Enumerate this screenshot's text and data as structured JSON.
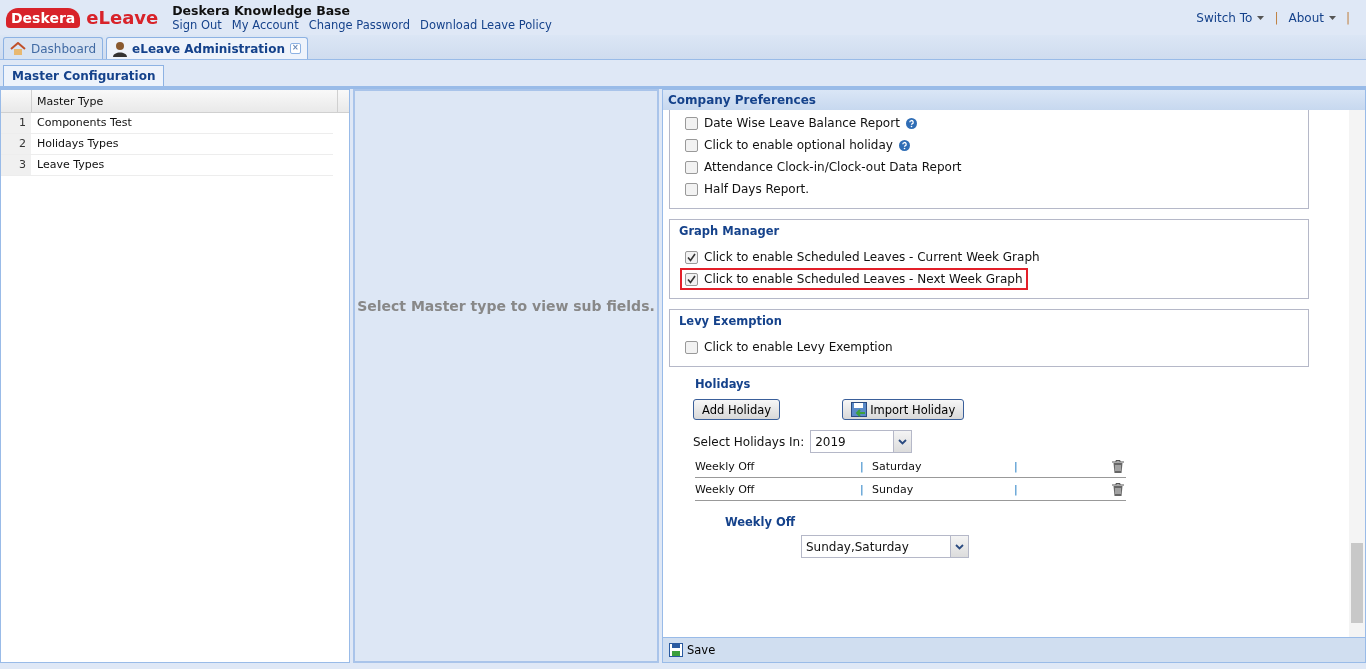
{
  "header": {
    "logo_brand": "Desk",
    "logo_brand_rest": "era",
    "app_name": "eLeave",
    "site_title": "Deskera Knowledge Base",
    "links": [
      "Sign Out",
      "My Account",
      "Change Password",
      "Download Leave Policy"
    ],
    "menus": [
      "Switch To",
      "About"
    ],
    "separator": "|"
  },
  "tabs": [
    {
      "label": "Dashboard",
      "selected": false,
      "kind": "home"
    },
    {
      "label": "eLeave Administration",
      "selected": true,
      "kind": "admin",
      "close": "×"
    }
  ],
  "sub_tabs": [
    {
      "label": "Master Configuration",
      "selected": true
    }
  ],
  "master_grid": {
    "column": "Master Type",
    "rows": [
      {
        "number": "1",
        "name": "Components Test"
      },
      {
        "number": "2",
        "name": "Holidays Types"
      },
      {
        "number": "3",
        "name": "Leave Types"
      }
    ]
  },
  "middle_message": "Select Master type to view sub fields.",
  "preferences": {
    "title": "Company Preferences",
    "report_options": [
      {
        "label": "Date Wise Leave Balance Report",
        "checked": false,
        "help": true
      },
      {
        "label": "Click to enable optional holiday",
        "checked": false,
        "help": true
      },
      {
        "label": "Attendance Clock-in/Clock-out Data Report",
        "checked": false,
        "help": false
      },
      {
        "label": "Half Days Report.",
        "checked": false,
        "help": false
      }
    ],
    "sections": [
      {
        "title": "Graph Manager",
        "options": [
          {
            "label": "Click to enable Scheduled Leaves - Current Week Graph",
            "checked": true,
            "highlighted": false
          },
          {
            "label": "Click to enable Scheduled Leaves - Next Week Graph",
            "checked": true,
            "highlighted": true
          }
        ]
      },
      {
        "title": "Levy Exemption",
        "options": [
          {
            "label": "Click to enable Levy Exemption",
            "checked": false,
            "highlighted": false
          }
        ]
      }
    ],
    "holidays": {
      "title": "Holidays",
      "add_button": "Add Holiday",
      "import_button": "Import Holiday",
      "year_label": "Select Holidays In:",
      "year": "2019",
      "separator": "|",
      "rows": [
        {
          "type": "Weekly Off",
          "day": "Saturday"
        },
        {
          "type": "Weekly Off",
          "day": "Sunday"
        }
      ]
    },
    "weekly_off": {
      "title": "Weekly Off",
      "value": "Sunday,Saturday"
    },
    "save_button": "Save"
  }
}
